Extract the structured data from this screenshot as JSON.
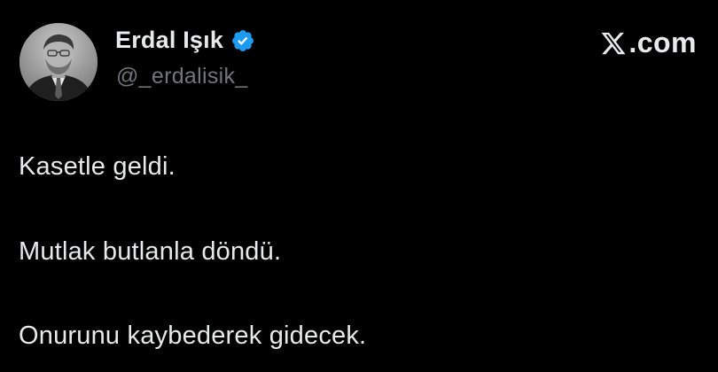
{
  "author": {
    "display_name": "Erdal Işık",
    "handle": "@_erdalisik_",
    "verified": true,
    "verified_color": "#1d9bf0"
  },
  "brand": {
    "text": ".com",
    "logo_icon": "x-logo-icon"
  },
  "tweet": {
    "lines": [
      "Kasetle geldi.",
      "Mutlak butlanla döndü.",
      "Onurunu kaybederek gidecek."
    ]
  },
  "colors": {
    "background": "#000000",
    "primary_text": "#e7e9ea",
    "secondary_text": "#71767b"
  }
}
